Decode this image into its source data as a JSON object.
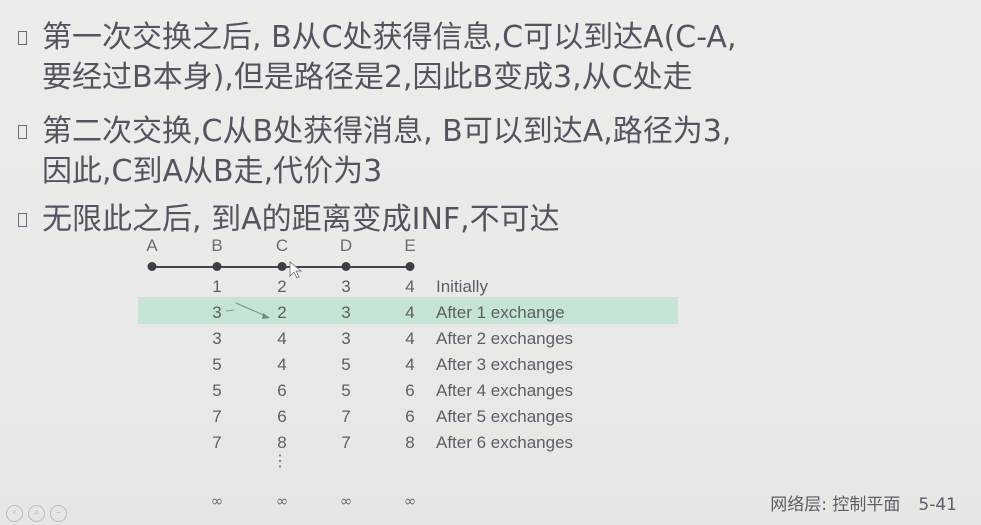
{
  "paragraphs": [
    {
      "lines": [
        "第一次交换之后, B从C处获得信息,C可以到达A(C-A,",
        "要经过B本身),但是路径是2,因此B变成3,从C处走"
      ]
    },
    {
      "lines": [
        "第二次交换,C从B处获得消息, B可以到达A,路径为3,",
        "因此,C到A从B走,代价为3"
      ]
    },
    {
      "lines": [
        "无限此之后, 到A的距离变成INF,不可达"
      ]
    }
  ],
  "diagram": {
    "nodes": [
      "A",
      "B",
      "C",
      "D",
      "E"
    ],
    "rows": [
      {
        "values": [
          "1",
          "2",
          "3",
          "4"
        ],
        "label": "Initially"
      },
      {
        "values": [
          "3",
          "2",
          "3",
          "4"
        ],
        "label": "After 1 exchange",
        "highlight": true
      },
      {
        "values": [
          "3",
          "4",
          "3",
          "4"
        ],
        "label": "After 2 exchanges"
      },
      {
        "values": [
          "5",
          "4",
          "5",
          "4"
        ],
        "label": "After 3 exchanges"
      },
      {
        "values": [
          "5",
          "6",
          "5",
          "6"
        ],
        "label": "After 4 exchanges"
      },
      {
        "values": [
          "7",
          "6",
          "7",
          "6"
        ],
        "label": "After 5 exchanges"
      },
      {
        "values": [
          "7",
          "8",
          "7",
          "8"
        ],
        "label": "After 6 exchanges"
      }
    ],
    "ellipsis": "⋮",
    "infinity_row": [
      "∞",
      "∞",
      "∞",
      "∞"
    ]
  },
  "footer": {
    "title": "网络层: 控制平面",
    "page": "5-41"
  },
  "colors": {
    "highlight": "#bfe3cf",
    "text": "#525560",
    "background": "#ebecea"
  }
}
